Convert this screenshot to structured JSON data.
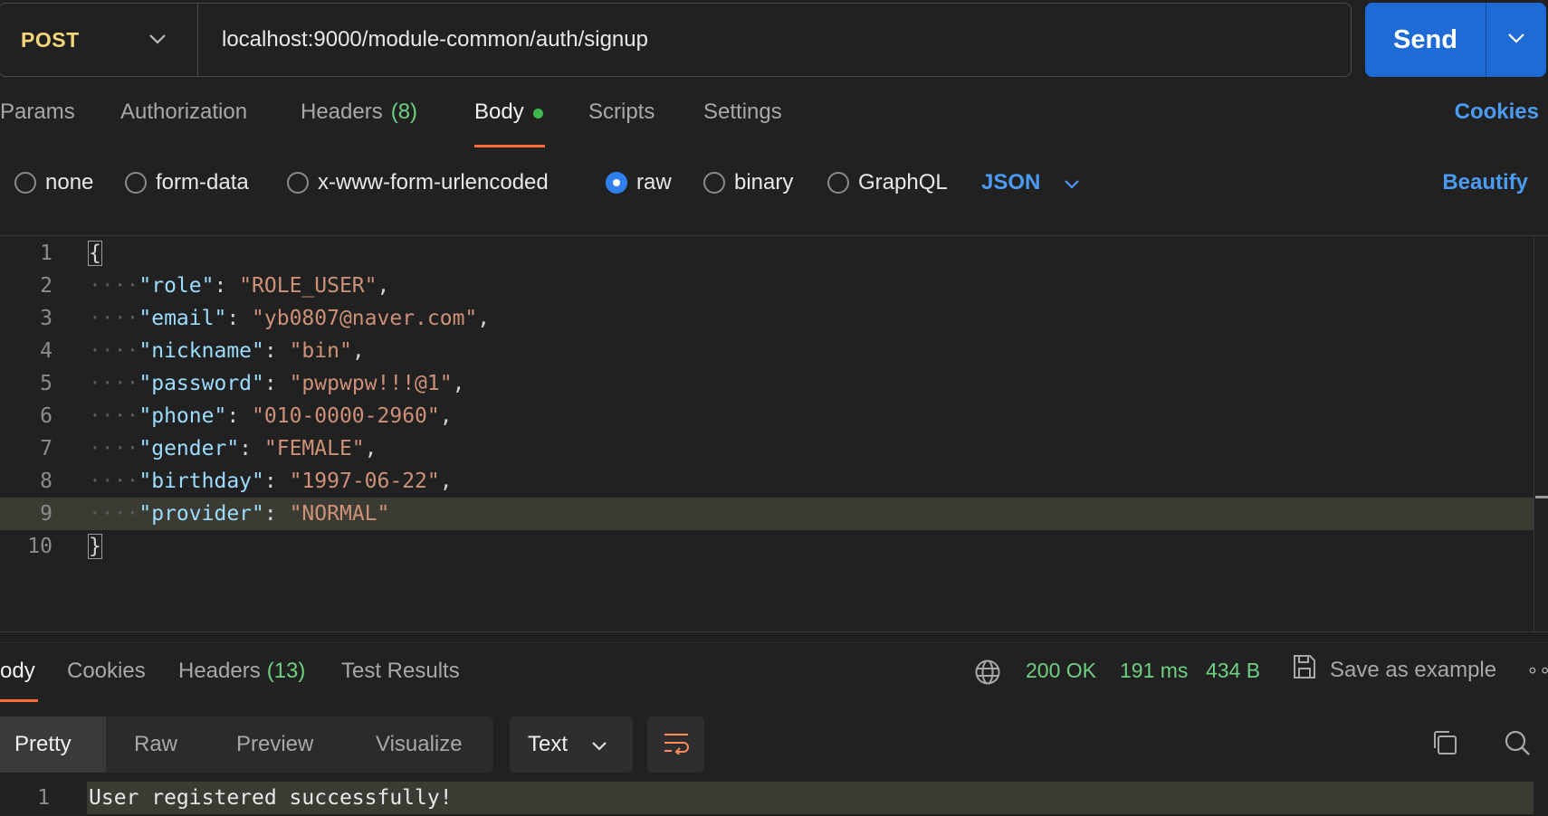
{
  "request": {
    "method": "POST",
    "url": "localhost:9000/module-common/auth/signup",
    "send_label": "Send"
  },
  "request_tabs": [
    {
      "label": "Params"
    },
    {
      "label": "Authorization"
    },
    {
      "label": "Headers",
      "count": "(8)"
    },
    {
      "label": "Body"
    },
    {
      "label": "Scripts"
    },
    {
      "label": "Settings"
    }
  ],
  "cookies_label": "Cookies",
  "body_types": [
    {
      "label": "none"
    },
    {
      "label": "form-data"
    },
    {
      "label": "x-www-form-urlencoded"
    },
    {
      "label": "raw",
      "selected": true
    },
    {
      "label": "binary"
    },
    {
      "label": "GraphQL"
    }
  ],
  "body_format": "JSON",
  "beautify_label": "Beautify",
  "editor": {
    "line_numbers": [
      "1",
      "2",
      "3",
      "4",
      "5",
      "6",
      "7",
      "8",
      "9",
      "10"
    ],
    "open_brace": "{",
    "close_brace": "}",
    "indent": "····",
    "fields": [
      {
        "key": "\"role\"",
        "value": "\"ROLE_USER\"",
        "comma": ","
      },
      {
        "key": "\"email\"",
        "value": "\"yb0807@naver.com\"",
        "comma": ","
      },
      {
        "key": "\"nickname\"",
        "value": "\"bin\"",
        "comma": ","
      },
      {
        "key": "\"password\"",
        "value": "\"pwpwpw!!!@1\"",
        "comma": ","
      },
      {
        "key": "\"phone\"",
        "value": "\"010-0000-2960\"",
        "comma": ","
      },
      {
        "key": "\"gender\"",
        "value": "\"FEMALE\"",
        "comma": ","
      },
      {
        "key": "\"birthday\"",
        "value": "\"1997-06-22\"",
        "comma": ","
      },
      {
        "key": "\"provider\"",
        "value": "\"NORMAL\"",
        "comma": ""
      }
    ]
  },
  "response_tabs": [
    {
      "label": "ody"
    },
    {
      "label": "Cookies"
    },
    {
      "label": "Headers",
      "count": "(13)"
    },
    {
      "label": "Test Results"
    }
  ],
  "response_status": {
    "status": "200 OK",
    "time": "191 ms",
    "size": "434 B",
    "save_label": "Save as example",
    "more": "∘∘"
  },
  "view_modes": [
    "Pretty",
    "Raw",
    "Preview",
    "Visualize"
  ],
  "response_format": "Text",
  "response_body": {
    "line_number": "1",
    "text": "User registered successfully!"
  },
  "colors": {
    "accent": "#ff6c37",
    "send": "#1e6bd6",
    "link": "#4b9bf0",
    "status_ok": "#6fcf82",
    "method": "#f5d67b"
  },
  "icons": [
    "chevron-down-icon",
    "globe-icon",
    "save-icon",
    "wrap-lines-icon",
    "copy-icon",
    "search-icon"
  ]
}
